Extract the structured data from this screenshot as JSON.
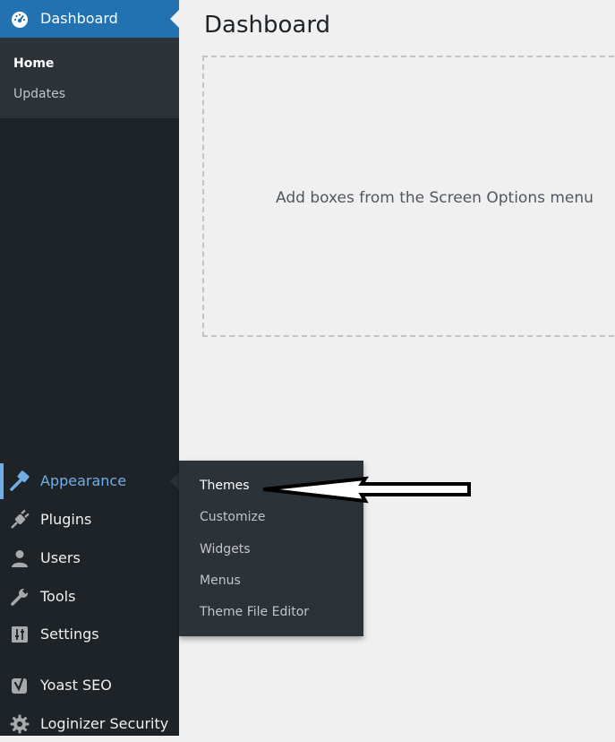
{
  "sidebar": {
    "dashboard": {
      "label": "Dashboard",
      "icon": "dashboard-gauge-icon",
      "submenu": [
        {
          "label": "Home",
          "current": true
        },
        {
          "label": "Updates",
          "current": false
        }
      ]
    },
    "items": [
      {
        "label": "Appearance",
        "icon": "paintbrush-icon",
        "active": true
      },
      {
        "label": "Plugins",
        "icon": "plug-icon"
      },
      {
        "label": "Users",
        "icon": "user-icon"
      },
      {
        "label": "Tools",
        "icon": "wrench-icon"
      },
      {
        "label": "Settings",
        "icon": "settings-sliders-icon"
      },
      {
        "label": "Yoast SEO",
        "icon": "yoast-icon"
      },
      {
        "label": "Loginizer Security",
        "icon": "gear-icon"
      }
    ]
  },
  "flyout": {
    "items": [
      "Themes",
      "Customize",
      "Widgets",
      "Menus",
      "Theme File Editor"
    ]
  },
  "main": {
    "title": "Dashboard",
    "empty_message": "Add boxes from the Screen Options menu"
  },
  "colors": {
    "sidebar_bg": "#1d2327",
    "submenu_bg": "#2c3338",
    "highlight": "#2271b1",
    "active_text": "#72aee6",
    "page_bg": "#f0f0f1"
  }
}
